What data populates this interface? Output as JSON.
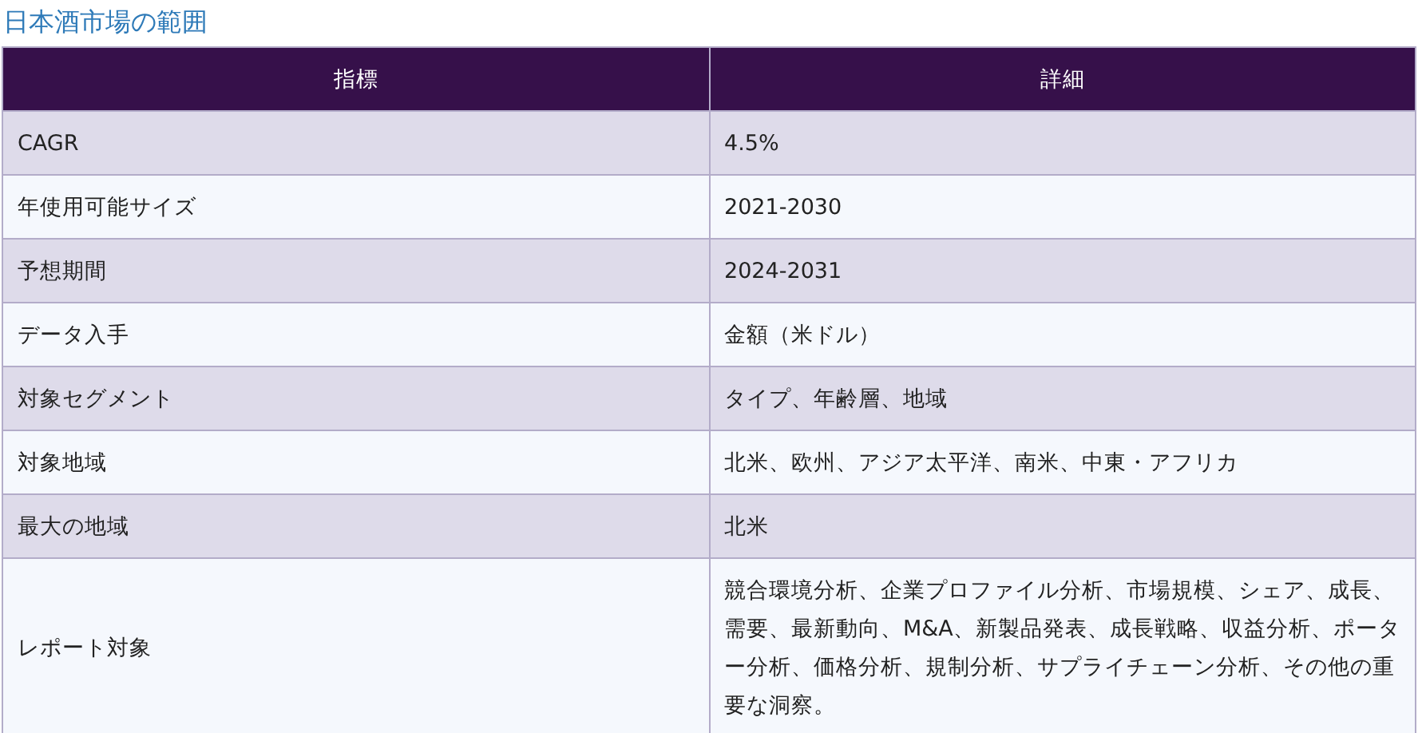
{
  "title": "日本酒市場の範囲",
  "table": {
    "columns": [
      "指標",
      "詳細"
    ],
    "rows": [
      [
        "CAGR",
        "4.5%"
      ],
      [
        "年使用可能サイズ",
        "2021-2030"
      ],
      [
        "予想期間",
        "2024-2031"
      ],
      [
        "データ入手",
        "金額（米ドル）"
      ],
      [
        "対象セグメント",
        "タイプ、年齢層、地域"
      ],
      [
        "対象地域",
        "北米、欧州、アジア太平洋、南米、中東・アフリカ"
      ],
      [
        "最大の地域",
        "北米"
      ],
      [
        "レポート対象",
        "競合環境分析、企業プロファイル分析、市場規模、シェア、成長、需要、最新動向、M&A、新製品発表、成長戦略、収益分析、ポーター分析、価格分析、規制分析、サプライチェーン分析、その他の重要な洞察。"
      ]
    ]
  }
}
